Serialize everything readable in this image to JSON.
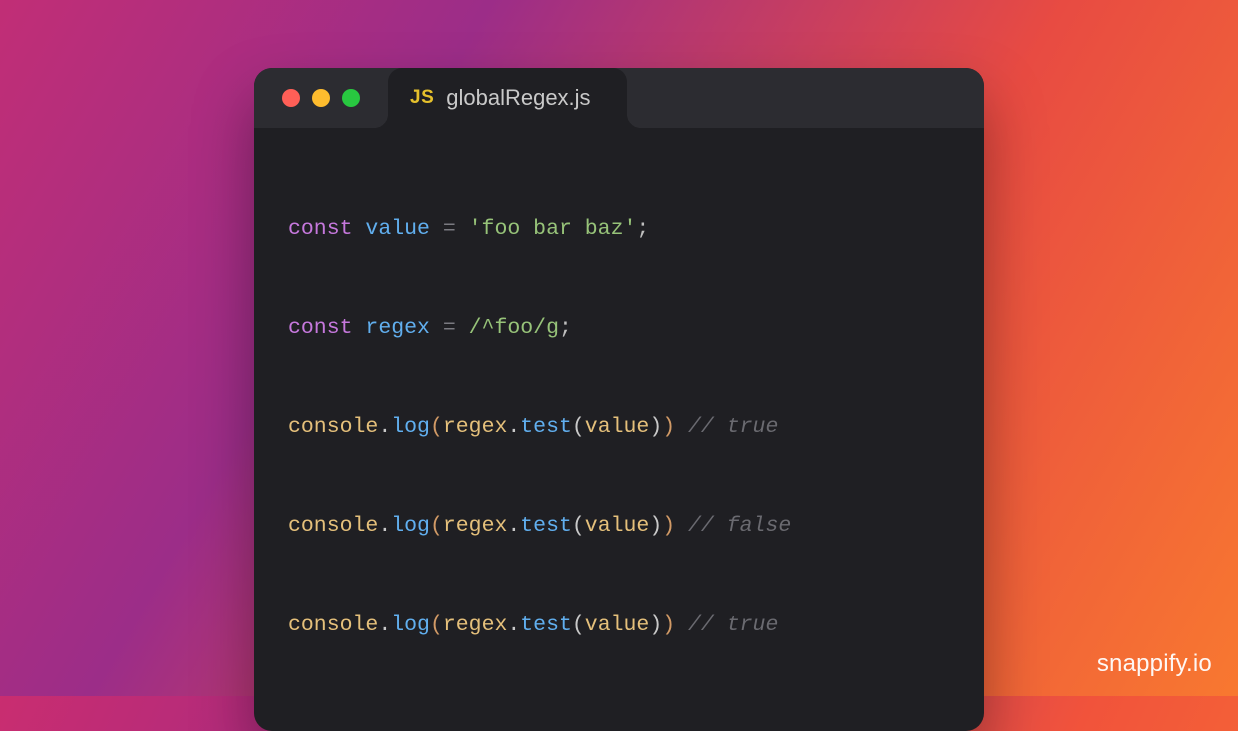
{
  "tab": {
    "badge": "JS",
    "filename": "globalRegex.js"
  },
  "code": {
    "l1": {
      "kw": "const",
      "sp1": " ",
      "name": "value",
      "sp2": " ",
      "eq": "=",
      "sp3": " ",
      "str": "'foo bar baz'",
      "semi": ";"
    },
    "l3": {
      "kw": "const",
      "sp1": " ",
      "name": "regex",
      "sp2": " ",
      "eq": "=",
      "sp3": " ",
      "regex": "/^foo/g",
      "semi": ";"
    },
    "l5": {
      "obj": "console",
      "dot": ".",
      "fn": "log",
      "lp": "(",
      "arg1": "regex",
      "dot2": ".",
      "m": "test",
      "lp2": "(",
      "arg2": "value",
      "rp2": ")",
      "rp": ")",
      "sp": " ",
      "comm": "// true"
    },
    "l7": {
      "obj": "console",
      "dot": ".",
      "fn": "log",
      "lp": "(",
      "arg1": "regex",
      "dot2": ".",
      "m": "test",
      "lp2": "(",
      "arg2": "value",
      "rp2": ")",
      "rp": ")",
      "sp": " ",
      "comm": "// false"
    },
    "l9": {
      "obj": "console",
      "dot": ".",
      "fn": "log",
      "lp": "(",
      "arg1": "regex",
      "dot2": ".",
      "m": "test",
      "lp2": "(",
      "arg2": "value",
      "rp2": ")",
      "rp": ")",
      "sp": " ",
      "comm": "// true"
    }
  },
  "watermark": "snappify.io"
}
